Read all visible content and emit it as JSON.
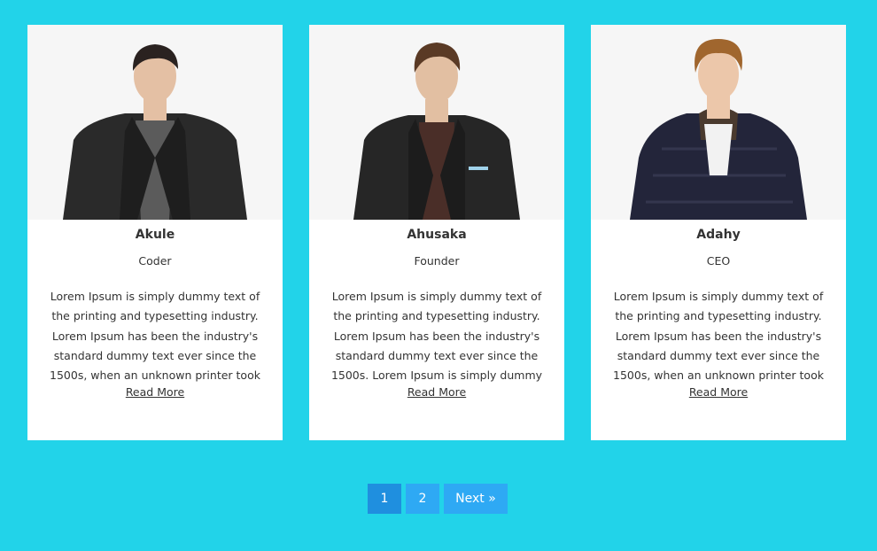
{
  "team": [
    {
      "name": "Akule",
      "role": "Coder",
      "description": "Lorem Ipsum is simply dummy text of the printing and typesetting industry. Lorem Ipsum has been the industry's standard dummy text ever since the 1500s, when an unknown printer took",
      "link": "Read More",
      "colors": {
        "hair": "#2a2220",
        "skin": "#e4c0a4",
        "coat": "#2a2a2a",
        "inner": "#5b5b5b"
      }
    },
    {
      "name": "Ahusaka",
      "role": "Founder",
      "description": "Lorem Ipsum is simply dummy text of the printing and typesetting industry. Lorem Ipsum has been the industry's standard dummy text ever since the 1500s. Lorem Ipsum is simply dummy",
      "link": "Read More",
      "colors": {
        "hair": "#5a3a25",
        "skin": "#e2bfa2",
        "coat": "#262626",
        "inner": "#4a2e28"
      }
    },
    {
      "name": "Adahy",
      "role": "CEO",
      "description": "Lorem Ipsum is simply dummy text of the printing and typesetting industry. Lorem Ipsum has been the industry's standard dummy text ever since the 1500s, when an unknown printer took",
      "link": "Read More",
      "colors": {
        "hair": "#a0662e",
        "skin": "#ecc7aa",
        "coat": "#23253a",
        "inner": "#f2f2f2"
      }
    }
  ],
  "pagination": {
    "pages": [
      "1",
      "2"
    ],
    "active": "1",
    "next": "Next »"
  },
  "background": "#22d3e9"
}
